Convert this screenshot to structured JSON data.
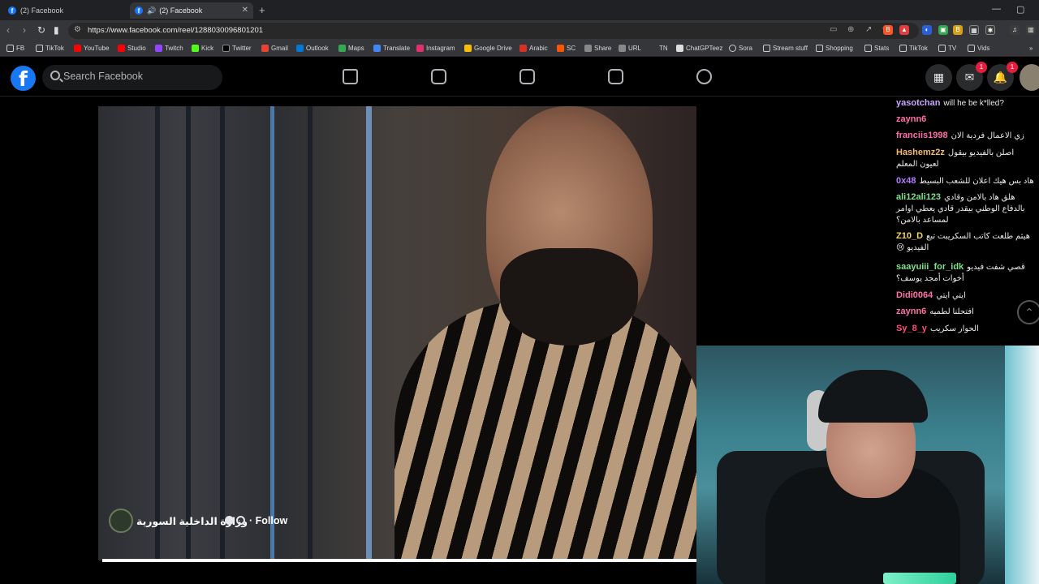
{
  "browser": {
    "tabs": [
      {
        "title": "(2) Facebook",
        "active": false
      },
      {
        "title": "(2) Facebook",
        "active": true
      }
    ],
    "url": "https://www.facebook.com/reel/1288030096801201",
    "bookmarks": [
      "FB",
      "TikTok",
      "YouTube",
      "Studio",
      "Twitch",
      "Kick",
      "Twitter",
      "Gmail",
      "Outlook",
      "Maps",
      "Translate",
      "Instagram",
      "Google Drive",
      "Arabic",
      "SC",
      "Share",
      "URL",
      "TN",
      "ChatGPTeez",
      "Sora",
      "Stream stuff",
      "Shopping",
      "Stats",
      "TikTok",
      "TV",
      "Vids"
    ]
  },
  "facebook": {
    "logo": "f",
    "search_placeholder": "Search Facebook",
    "messenger_badge": "1",
    "notifications_badge": "1"
  },
  "reel": {
    "page_name": "وزارة الداخلية السورية",
    "follow_label": "· Follow",
    "progress": 1.0
  },
  "chat": [
    {
      "user": "yasotchan",
      "color": "#c9a6ff",
      "text": "will he be k*lled?"
    },
    {
      "user": "zaynn6",
      "color": "#ff6fa8",
      "text": ""
    },
    {
      "user": "franciis1998",
      "color": "#ff6fa8",
      "text": "زي الاعمال فردية الان"
    },
    {
      "user": "Hashemz2z",
      "color": "#f6b86a",
      "text": "اصلن بالفيديو بيقول لعيون المعلم"
    },
    {
      "user": "0x48",
      "color": "#b27bff",
      "text": "هاد بس هيك اعلان للشعب البسيط"
    },
    {
      "user": "ali12ali123",
      "color": "#7ee08a",
      "text": "هلق هاد بالامن وقادي بالدفاع الوطني بيقدر قادي يعطي اوامر لمساعد بالامن؟"
    },
    {
      "user": "Z10_D",
      "color": "#f2d35b",
      "text": "هيثم طلعت كاتب السكريبت تبع الفيديو 😢"
    },
    {
      "user": "saayuiii_for_idk",
      "color": "#7ee08a",
      "text": "قصي شفت فيديو أخوات أمجد يوسف؟"
    },
    {
      "user": "Didi0064",
      "color": "#ff6fa8",
      "text": "ايتي ايتي"
    },
    {
      "user": "zaynn6",
      "color": "#ff6fa8",
      "text": "افتحلنا لطميه"
    },
    {
      "user": "Sy_8_y",
      "color": "#ff4f7a",
      "text": "الحوار سكريب"
    }
  ]
}
